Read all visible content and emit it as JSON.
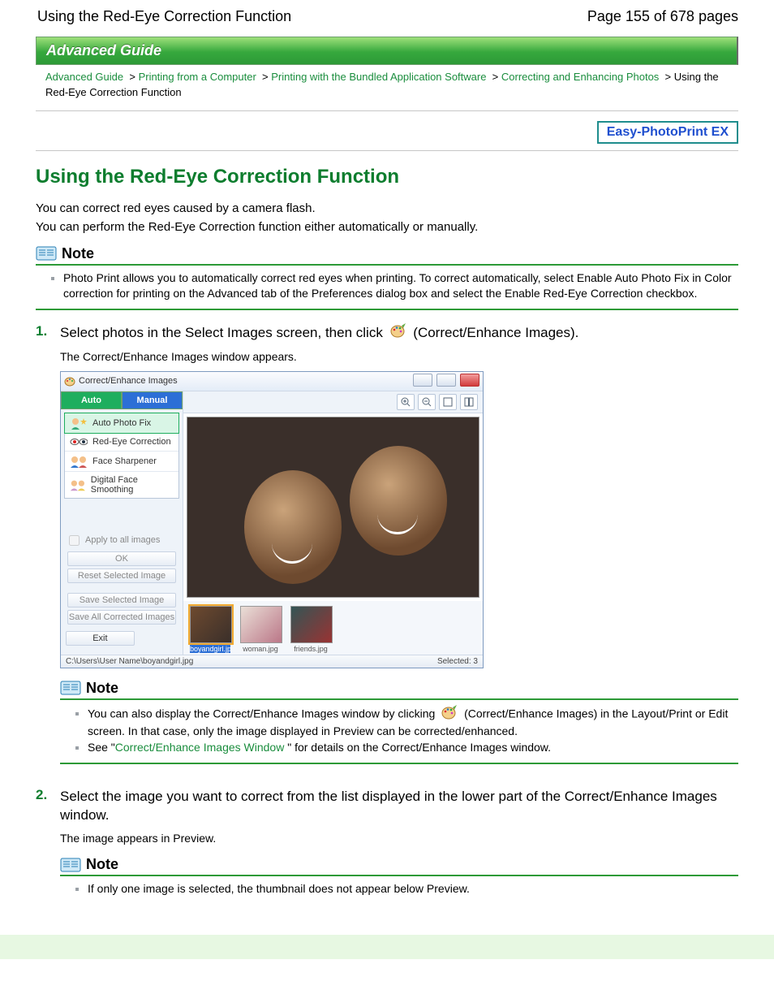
{
  "header": {
    "title": "Using the Red-Eye Correction Function",
    "page": "Page 155 of 678 pages"
  },
  "guide_bar": "Advanced Guide",
  "crumbs": {
    "c1": "Advanced Guide",
    "c2": "Printing from a Computer",
    "c3": "Printing with the Bundled Application Software",
    "c4": "Correcting and Enhancing Photos",
    "cur": "Using the Red-Eye Correction Function"
  },
  "badge": "Easy-PhotoPrint EX",
  "h1": "Using the Red-Eye Correction Function",
  "intro1": "You can correct red eyes caused by a camera flash.",
  "intro2": "You can perform the Red-Eye Correction function either automatically or manually.",
  "note_label": "Note",
  "note1": {
    "b1": "Photo Print allows you to automatically correct red eyes when printing. To correct automatically, select Enable Auto Photo Fix in Color correction for printing on the Advanced tab of the Preferences dialog box and select the Enable Red-Eye Correction checkbox."
  },
  "step1": {
    "num": "1.",
    "lead_a": "Select photos in the Select Images screen, then click ",
    "lead_b": " (Correct/Enhance Images).",
    "sub": "The Correct/Enhance Images window appears."
  },
  "win": {
    "title": "Correct/Enhance Images",
    "tabs": {
      "auto": "Auto",
      "manual": "Manual"
    },
    "fx": {
      "a": "Auto Photo Fix",
      "b": "Red-Eye Correction",
      "c": "Face Sharpener",
      "d": "Digital Face Smoothing"
    },
    "apply_all": "Apply to all images",
    "btn_ok": "OK",
    "btn_reset": "Reset Selected Image",
    "btn_save_sel": "Save Selected Image",
    "btn_save_all": "Save All Corrected Images",
    "btn_exit": "Exit",
    "thumbs": {
      "t1": "boyandgirl.jpg",
      "t2": "woman.jpg",
      "t3": "friends.jpg"
    },
    "status_path": "C:\\Users\\User Name\\boyandgirl.jpg",
    "status_sel": "Selected: 3"
  },
  "note2": {
    "b1a": "You can also display the Correct/Enhance Images window by clicking ",
    "b1b": " (Correct/Enhance Images) in the Layout/Print or Edit screen. In that case, only the image displayed in Preview can be corrected/enhanced.",
    "b2a": "See \"",
    "b2link": "Correct/Enhance Images Window",
    "b2b": " \" for details on the Correct/Enhance Images window."
  },
  "step2": {
    "num": "2.",
    "lead": "Select the image you want to correct from the list displayed in the lower part of the Correct/Enhance Images window.",
    "sub": "The image appears in Preview."
  },
  "note3": {
    "b1": "If only one image is selected, the thumbnail does not appear below Preview."
  }
}
